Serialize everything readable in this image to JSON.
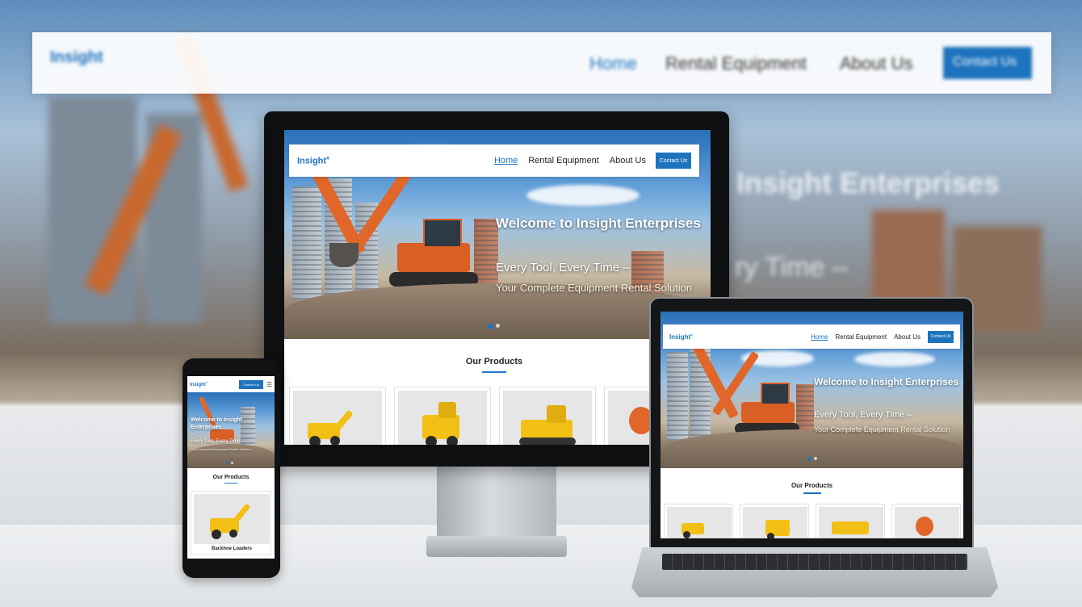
{
  "background": {
    "logo": "Insight",
    "nav": [
      "Home",
      "Rental Equipment",
      "About Us"
    ],
    "contact": "Contact Us",
    "heading": "Insight Enterprises",
    "sub": "ry Time –"
  },
  "site": {
    "logo": "Insight",
    "nav": {
      "home": "Home",
      "rental": "Rental Equipment",
      "about": "About Us",
      "contact": "Contact Us"
    },
    "hero": {
      "title": "Welcome to Insight Enterprises",
      "line1": "Every Tool, Every Time –",
      "line2": "Your Complete Equipment Rental Solution"
    },
    "products_title": "Our Products",
    "phone_product": "Backhoe Loaders"
  },
  "colors": {
    "accent": "#1e73be",
    "excavator": "#e0662a",
    "machine_yellow": "#f2bf15"
  },
  "icons": {
    "menu": "hamburger-menu-icon"
  }
}
